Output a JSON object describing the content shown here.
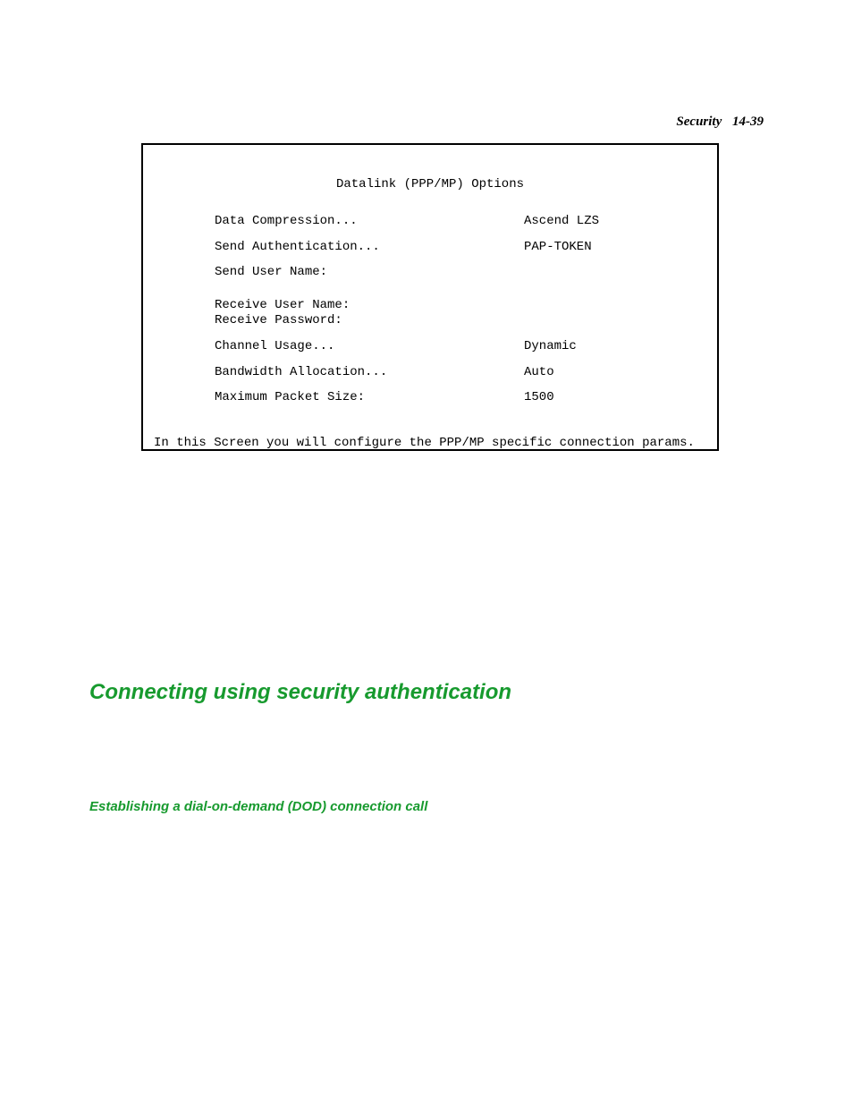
{
  "header": {
    "section": "Security",
    "page_number": "14-39"
  },
  "terminal": {
    "title": "Datalink (PPP/MP) Options",
    "rows": [
      {
        "label": "Data Compression...",
        "value": "Ascend LZS"
      },
      {
        "label": "Send Authentication...",
        "value": "PAP-TOKEN"
      },
      {
        "label": "Send User Name:",
        "value": ""
      },
      {
        "label": "Receive User Name:",
        "value": ""
      },
      {
        "label": "Receive Password:",
        "value": ""
      },
      {
        "label": "Channel Usage...",
        "value": "Dynamic"
      },
      {
        "label": "Bandwidth Allocation...",
        "value": "Auto"
      },
      {
        "label": "Maximum Packet Size:",
        "value": "1500"
      }
    ],
    "footer": "In this Screen you will configure the PPP/MP specific connection params."
  },
  "headings": {
    "h1": "Connecting using security authentication",
    "h2": "Establishing a dial-on-demand (DOD) connection call"
  }
}
